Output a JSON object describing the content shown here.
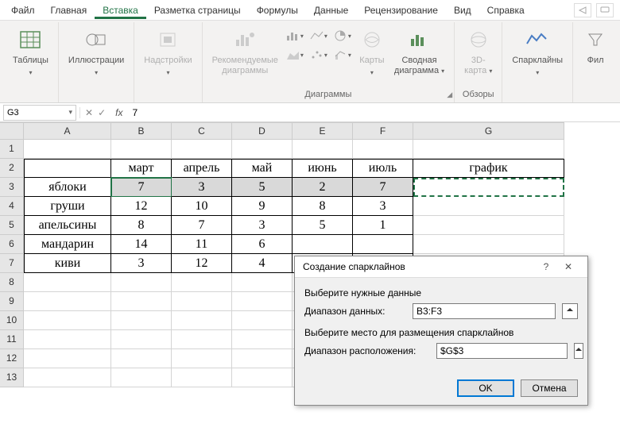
{
  "menu": {
    "items": [
      "Файл",
      "Главная",
      "Вставка",
      "Разметка страницы",
      "Формулы",
      "Данные",
      "Рецензирование",
      "Вид",
      "Справка"
    ],
    "active_index": 2
  },
  "ribbon": {
    "tables": {
      "label": "Таблицы"
    },
    "illustrations": {
      "label": "Иллюстрации"
    },
    "addins": {
      "label": "Надстройки"
    },
    "recommended": {
      "line1": "Рекомендуемые",
      "line2": "диаграммы"
    },
    "maps": {
      "label": "Карты"
    },
    "pivot": {
      "line1": "Сводная",
      "line2": "диаграмма"
    },
    "map3d": {
      "line1": "3D-",
      "line2": "карта"
    },
    "sparklines": {
      "label": "Спарклайны"
    },
    "filters": {
      "label": "Фил"
    },
    "group_charts": "Диаграммы",
    "group_tours": "Обзоры"
  },
  "namebox": "G3",
  "formula": "7",
  "columns": [
    "A",
    "B",
    "C",
    "D",
    "E",
    "F",
    "G"
  ],
  "rows": [
    "1",
    "2",
    "3",
    "4",
    "5",
    "6",
    "7",
    "8",
    "9",
    "10",
    "11",
    "12",
    "13"
  ],
  "table": {
    "headers": [
      "",
      "март",
      "апрель",
      "май",
      "июнь",
      "июль",
      "график"
    ],
    "rows": [
      {
        "label": "яблоки",
        "vals": [
          "7",
          "3",
          "5",
          "2",
          "7"
        ]
      },
      {
        "label": "груши",
        "vals": [
          "12",
          "10",
          "9",
          "8",
          "3"
        ]
      },
      {
        "label": "апельсины",
        "vals": [
          "8",
          "7",
          "3",
          "5",
          "1"
        ]
      },
      {
        "label": "мандарин",
        "vals": [
          "14",
          "11",
          "6",
          "",
          ""
        ]
      },
      {
        "label": "киви",
        "vals": [
          "3",
          "12",
          "4",
          "",
          ""
        ]
      }
    ]
  },
  "dialog": {
    "title": "Создание спарклайнов",
    "help": "?",
    "close": "✕",
    "section1": "Выберите нужные данные",
    "data_range_label": "Диапазон данных:",
    "data_range_value": "B3:F3",
    "section2": "Выберите место для размещения спарклайнов",
    "location_label": "Диапазон расположения:",
    "location_value": "$G$3",
    "ok": "OK",
    "cancel": "Отмена"
  },
  "chart_data": {
    "type": "table",
    "title": "",
    "columns": [
      "",
      "март",
      "апрель",
      "май",
      "июнь",
      "июль"
    ],
    "rows": [
      {
        "label": "яблоки",
        "values": [
          7,
          3,
          5,
          2,
          7
        ]
      },
      {
        "label": "груши",
        "values": [
          12,
          10,
          9,
          8,
          3
        ]
      },
      {
        "label": "апельсины",
        "values": [
          8,
          7,
          3,
          5,
          1
        ]
      },
      {
        "label": "мандарин",
        "values": [
          14,
          11,
          6,
          null,
          null
        ]
      },
      {
        "label": "киви",
        "values": [
          3,
          12,
          4,
          null,
          null
        ]
      }
    ]
  }
}
